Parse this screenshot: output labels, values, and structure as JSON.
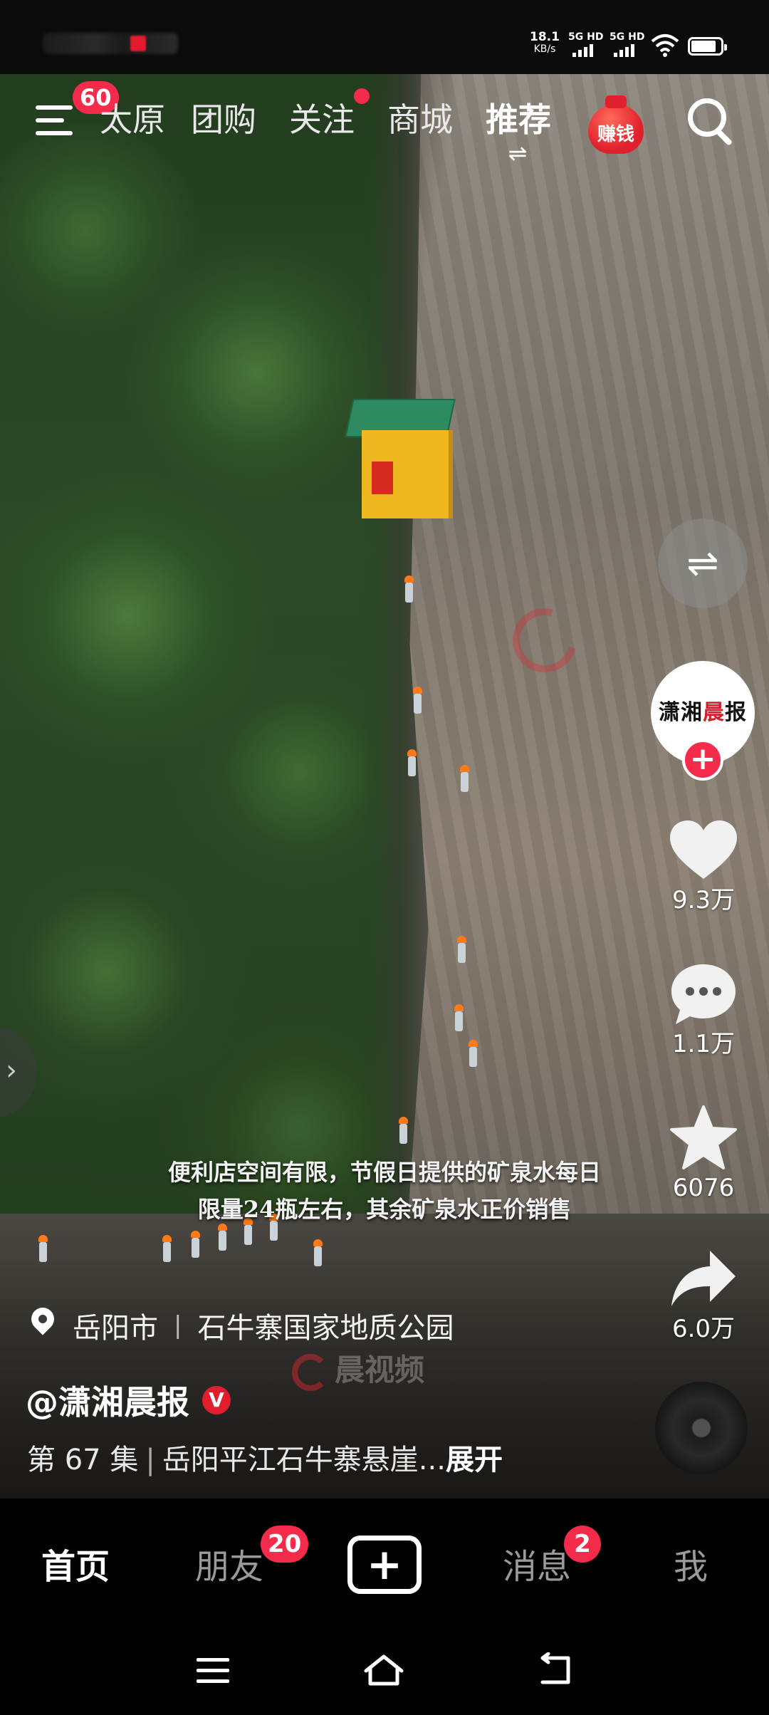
{
  "status_bar": {
    "net_speed": "18.1",
    "net_unit": "KB/s",
    "sim1_label": "5G HD",
    "sim2_label": "5G HD",
    "wifi_icon": "wifi-icon",
    "battery_level_percent": 85
  },
  "top_nav": {
    "menu_badge": "60",
    "tabs": [
      {
        "label": "太原",
        "active": false
      },
      {
        "label": "团购",
        "active": false
      },
      {
        "label": "关注",
        "active": false,
        "has_dot": true
      },
      {
        "label": "商城",
        "active": false
      },
      {
        "label": "推荐",
        "active": true
      }
    ],
    "swap_icon": "⇌",
    "earn_label": "赚钱",
    "search_icon": "search-icon"
  },
  "video": {
    "caption_line1": "便利店空间有限，节假日提供的矿泉水每日",
    "caption_line2": "限量24瓶左右，其余矿泉水正价销售",
    "watermark": "晨视频"
  },
  "side_actions": {
    "swap_icon": "⇌",
    "author_avatar_text_a": "潇湘",
    "author_avatar_text_b": "晨",
    "author_avatar_text_c": "报",
    "follow_icon": "+",
    "likes": "9.3万",
    "comments": "1.1万",
    "favorites": "6076",
    "shares": "6.0万"
  },
  "info": {
    "city": "岳阳市",
    "place": "石牛寨国家地质公园",
    "author": "@潇湘晨报",
    "verified_mark": "V",
    "episode": "第 67 集",
    "title": "岳阳平江石牛寨悬崖...",
    "expand_label": "展开"
  },
  "bottom_tabs": {
    "home": "首页",
    "friends": "朋友",
    "friends_badge": "20",
    "create_icon": "+",
    "messages": "消息",
    "messages_badge": "2",
    "me": "我"
  },
  "system_nav": {
    "menu_icon": "menu-icon",
    "home_icon": "home-icon",
    "back_icon": "back-icon"
  },
  "colors": {
    "accent_red": "#f42b4b",
    "brand_red": "#e01e2d"
  }
}
